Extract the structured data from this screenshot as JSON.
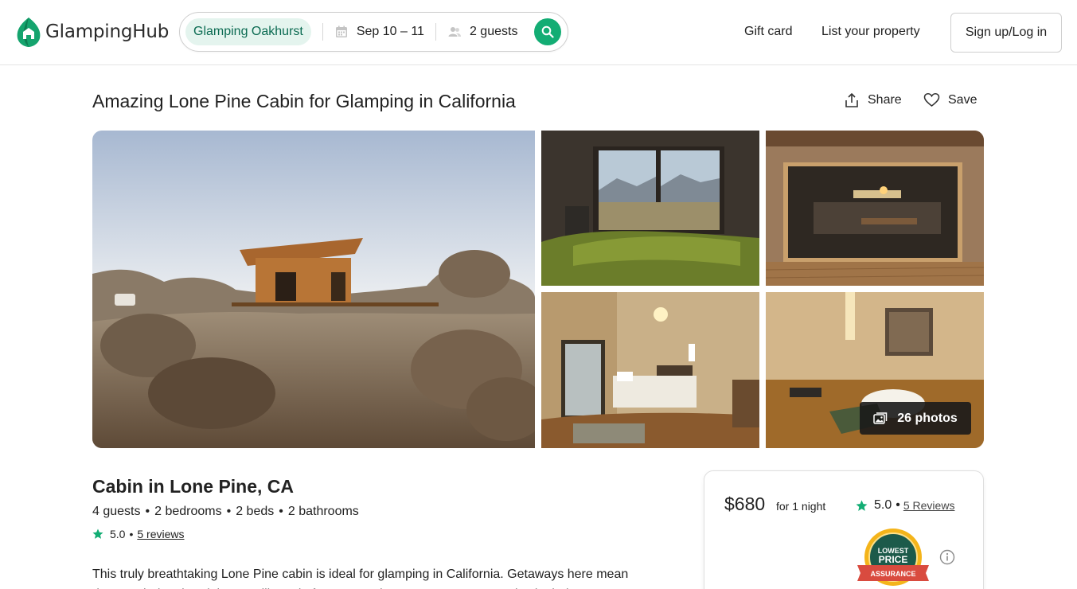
{
  "header": {
    "logo_text": "GlampingHub",
    "search": {
      "location": "Glamping Oakhurst",
      "dates": "Sep 10 – 11",
      "guests": "2 guests"
    },
    "nav": {
      "gift_card": "Gift card",
      "list_property": "List your property",
      "signup": "Sign up/Log in"
    }
  },
  "listing": {
    "title": "Amazing Lone Pine Cabin for Glamping in California",
    "share_label": "Share",
    "save_label": "Save",
    "photos_button": "26 photos",
    "subtitle": "Cabin in Lone Pine, CA",
    "specs": [
      "4 guests",
      "2 bedrooms",
      "2 beds",
      "2 bathrooms"
    ],
    "spec_separator": "•",
    "rating": "5.0",
    "reviews_link": "5 reviews",
    "description": "This truly breathtaking Lone Pine cabin is ideal for glamping in California. Getaways here mean days exploring the Alabama Hills and after some adventures, guests can relax in their custom"
  },
  "booking": {
    "price": "$680",
    "per_night": "for 1 night",
    "rating": "5.0",
    "rating_separator": "•",
    "reviews_link": "5 Reviews",
    "badge": {
      "line1": "LOWEST",
      "line2": "PRICE",
      "line3": "ASSURANCE"
    }
  },
  "colors": {
    "brand_green": "#13ad74",
    "chip_bg": "#e4f4ee",
    "chip_text": "#0b6b52",
    "star": "#13ad74"
  },
  "icons": [
    "calendar-icon",
    "guests-icon",
    "search-icon",
    "share-icon",
    "heart-icon",
    "photos-icon",
    "star-icon",
    "info-icon"
  ]
}
